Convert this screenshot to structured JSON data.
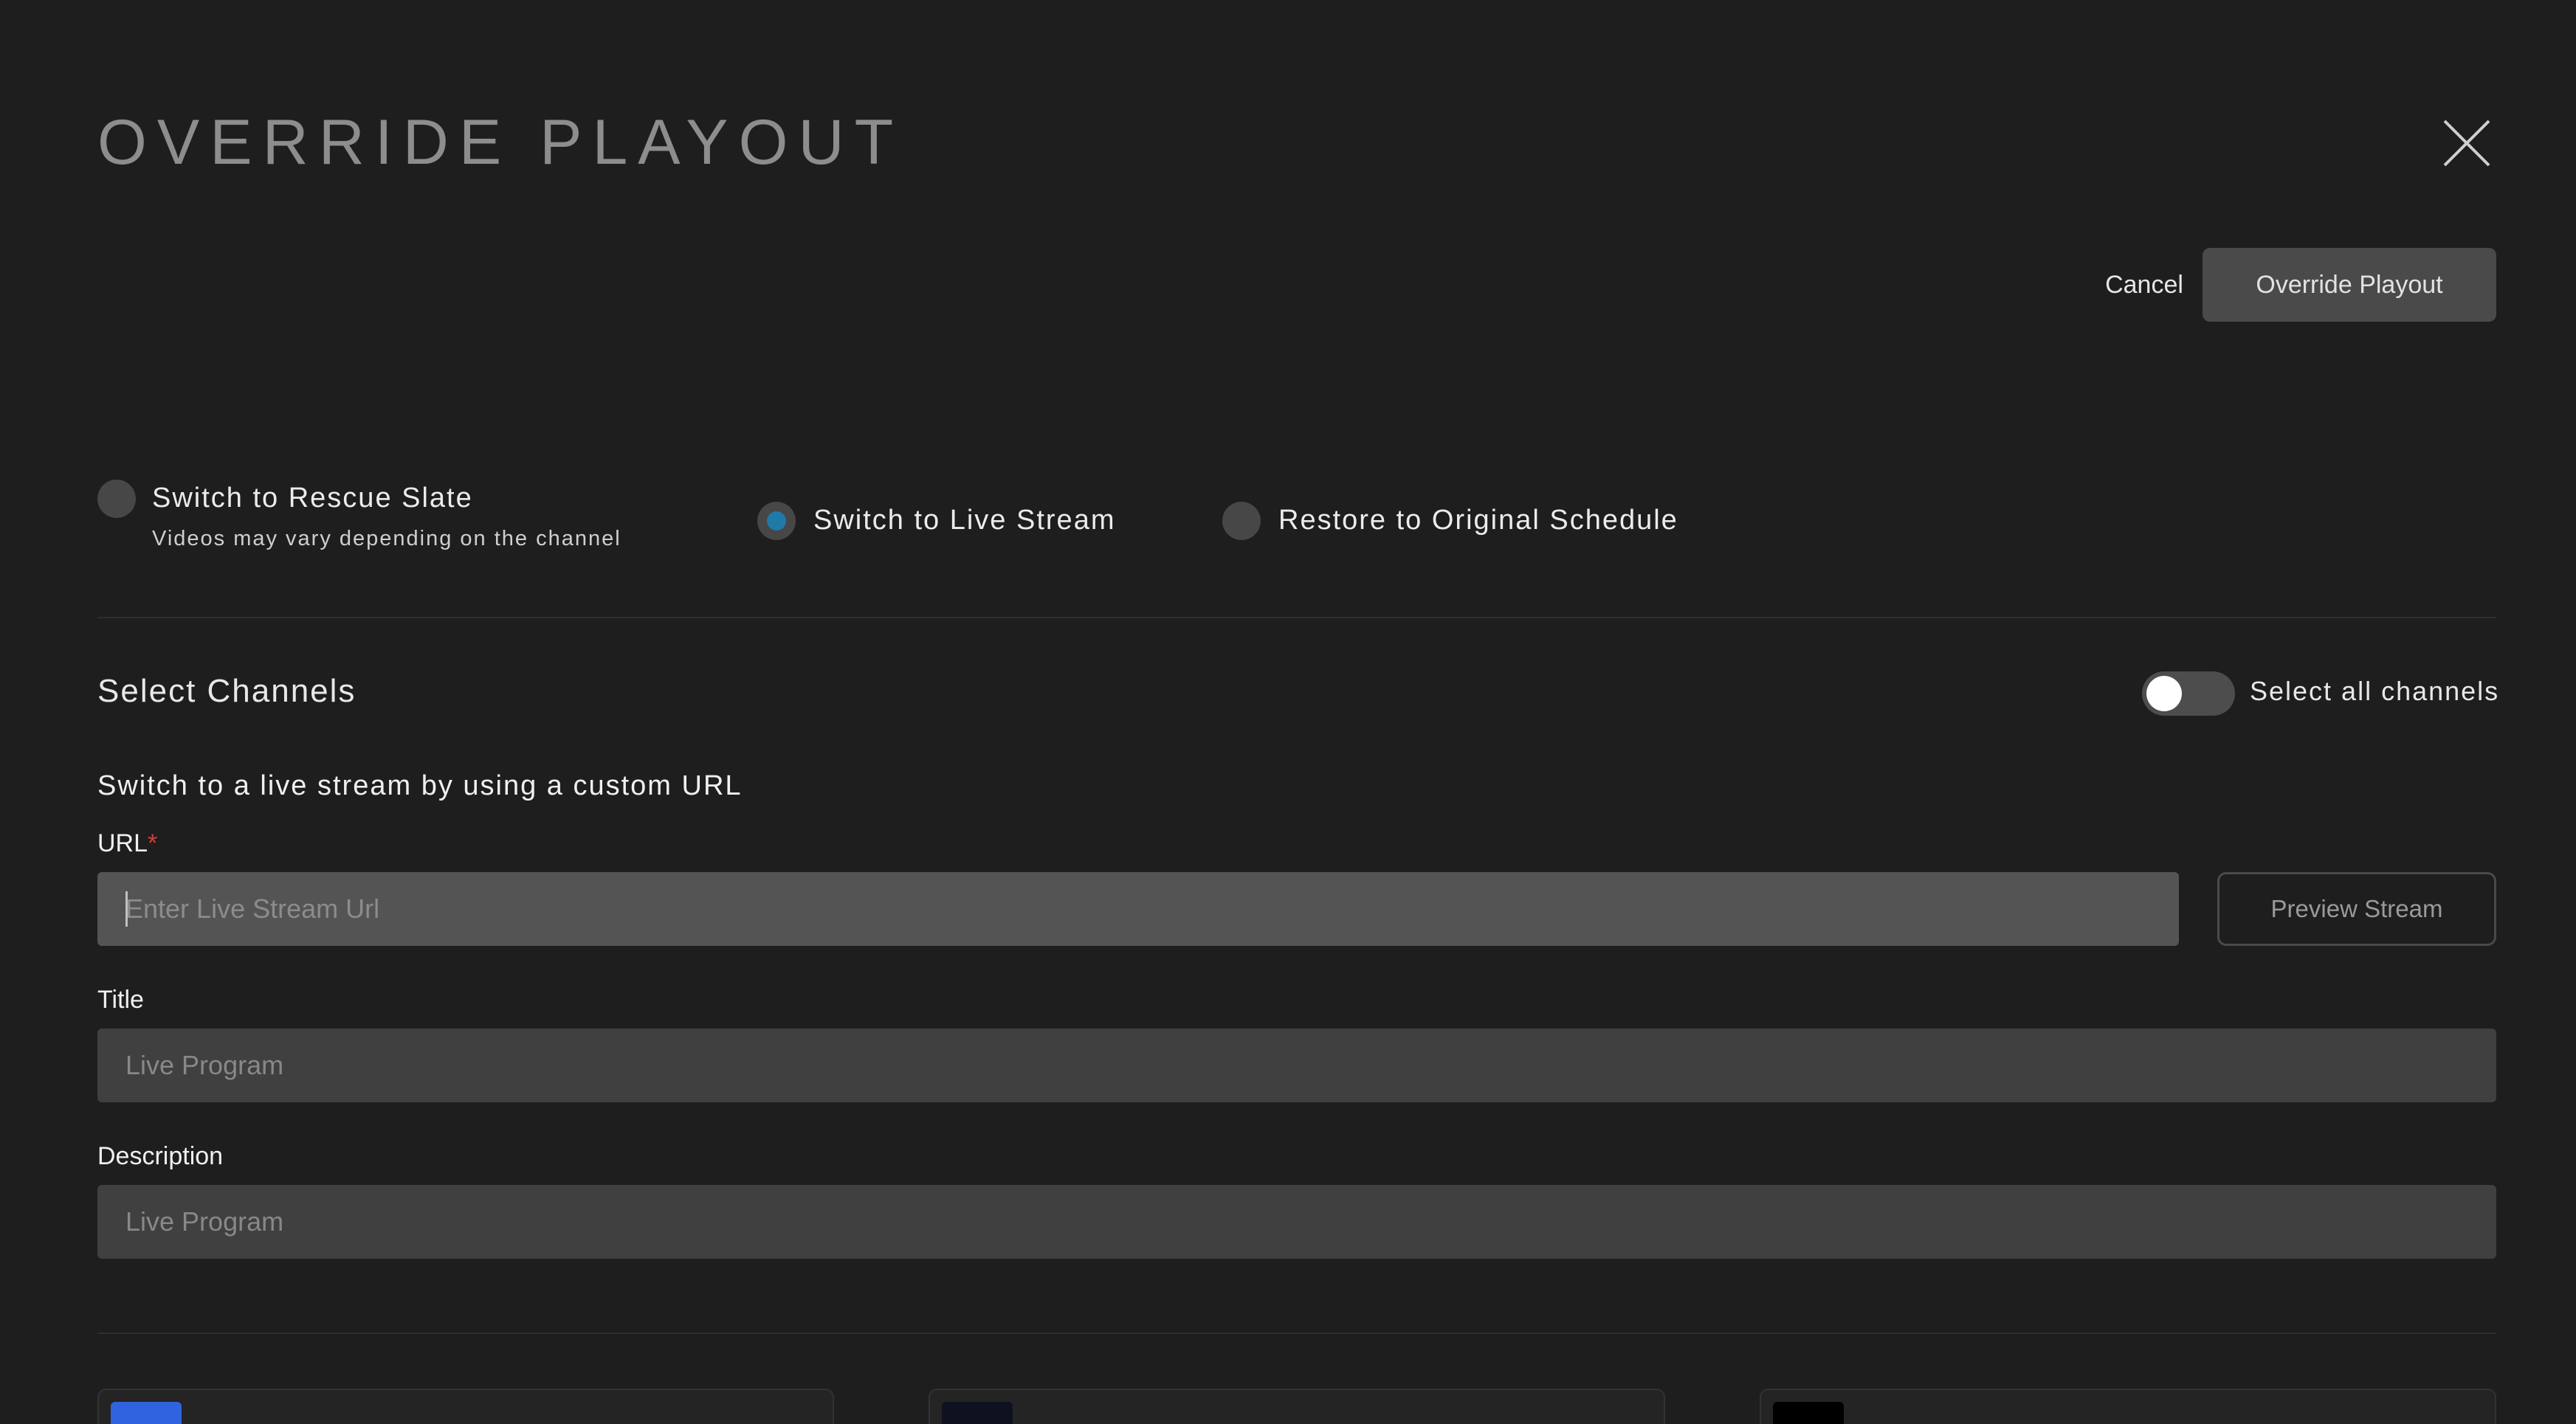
{
  "modal": {
    "title": "OVERRIDE PLAYOUT",
    "cancel_label": "Cancel",
    "override_label": "Override Playout"
  },
  "options": [
    {
      "label": "Switch to Rescue Slate",
      "sublabel": "Videos may vary depending on the channel",
      "selected": false
    },
    {
      "label": "Switch to Live Stream",
      "selected": true
    },
    {
      "label": "Restore to Original Schedule",
      "selected": false
    }
  ],
  "channels": {
    "title": "Select Channels",
    "select_all_label": "Select all channels",
    "select_all_on": false
  },
  "live_stream": {
    "heading": "Switch to a live stream by using a custom URL",
    "url_label": "URL",
    "url_required_mark": "*",
    "url_placeholder": "Enter Live Stream Url",
    "preview_label": "Preview Stream",
    "title_label": "Title",
    "title_placeholder": "Live Program",
    "description_label": "Description",
    "description_placeholder": "Live Program"
  },
  "channel_cards": [
    {
      "thumb_color": "#2f63e0"
    },
    {
      "thumb_color": "#0f1120"
    },
    {
      "thumb_color": "#000000"
    }
  ],
  "colors": {
    "background": "#1e1e1e",
    "accent": "#1f7aa8",
    "required": "#d43c3c"
  }
}
